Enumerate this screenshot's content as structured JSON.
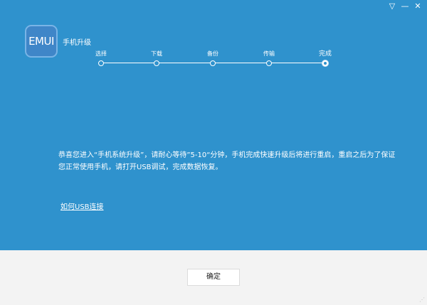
{
  "window": {
    "controls": [
      {
        "name": "dropdown-icon",
        "glyph": "▽"
      },
      {
        "name": "minimize-icon",
        "glyph": "—"
      },
      {
        "name": "close-icon",
        "glyph": "✕"
      }
    ]
  },
  "app": {
    "logo_text": "EMUI",
    "title": "手机升级"
  },
  "steps": [
    {
      "label": "选择"
    },
    {
      "label": "下载"
    },
    {
      "label": "备份"
    },
    {
      "label": "传输"
    },
    {
      "label": "完成"
    }
  ],
  "current_step": 4,
  "message": "恭喜您进入“手机系统升级”，请耐心等待”5-10“分钟，手机完成快速升级后将进行重启，重启之后为了保证您正常使用手机，请打开USB调试，完成数据恢复。",
  "link_usb": "如何USB连接",
  "confirm_button": "确定",
  "colors": {
    "primary_blue": "#2f92cd",
    "footer": "#f3f3f3"
  }
}
